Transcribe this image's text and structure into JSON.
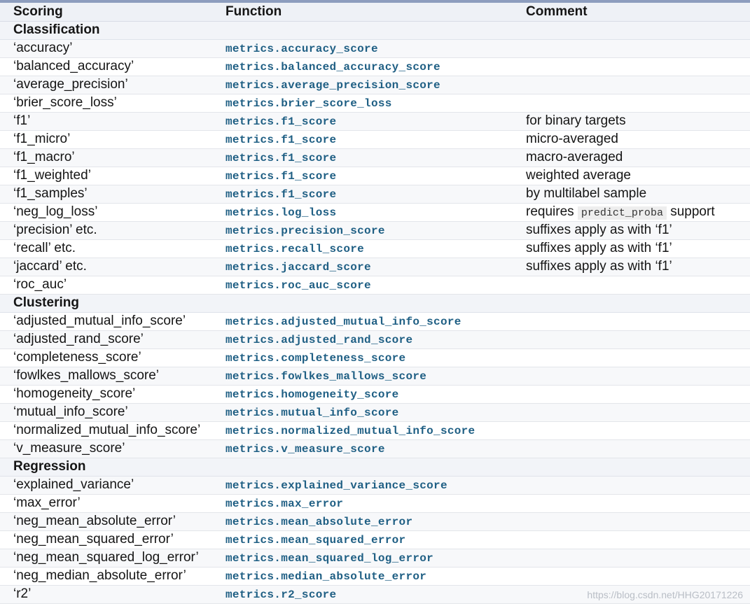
{
  "headers": {
    "scoring": "Scoring",
    "function": "Function",
    "comment": "Comment"
  },
  "sections": [
    {
      "title": "Classification",
      "rows": [
        {
          "scoring": "‘accuracy’",
          "func": "accuracy_score",
          "comment": ""
        },
        {
          "scoring": "‘balanced_accuracy’",
          "func": "balanced_accuracy_score",
          "comment": ""
        },
        {
          "scoring": "‘average_precision’",
          "func": "average_precision_score",
          "comment": ""
        },
        {
          "scoring": "‘brier_score_loss’",
          "func": "brier_score_loss",
          "comment": ""
        },
        {
          "scoring": "‘f1’",
          "func": "f1_score",
          "comment": "for binary targets"
        },
        {
          "scoring": "‘f1_micro’",
          "func": "f1_score",
          "comment": "micro-averaged"
        },
        {
          "scoring": "‘f1_macro’",
          "func": "f1_score",
          "comment": "macro-averaged"
        },
        {
          "scoring": "‘f1_weighted’",
          "func": "f1_score",
          "comment": "weighted average"
        },
        {
          "scoring": "‘f1_samples’",
          "func": "f1_score",
          "comment": "by multilabel sample"
        },
        {
          "scoring": "‘neg_log_loss’",
          "func": "log_loss",
          "comment": "requires ",
          "comment_code": "predict_proba",
          "comment_after": " support"
        },
        {
          "scoring": "‘precision’ etc.",
          "func": "precision_score",
          "comment": "suffixes apply as with ‘f1’"
        },
        {
          "scoring": "‘recall’ etc.",
          "func": "recall_score",
          "comment": "suffixes apply as with ‘f1’"
        },
        {
          "scoring": "‘jaccard’ etc.",
          "func": "jaccard_score",
          "comment": "suffixes apply as with ‘f1’"
        },
        {
          "scoring": "‘roc_auc’",
          "func": "roc_auc_score",
          "comment": ""
        }
      ]
    },
    {
      "title": "Clustering",
      "rows": [
        {
          "scoring": "‘adjusted_mutual_info_score’",
          "func": "adjusted_mutual_info_score",
          "comment": ""
        },
        {
          "scoring": "‘adjusted_rand_score’",
          "func": "adjusted_rand_score",
          "comment": ""
        },
        {
          "scoring": "‘completeness_score’",
          "func": "completeness_score",
          "comment": ""
        },
        {
          "scoring": "‘fowlkes_mallows_score’",
          "func": "fowlkes_mallows_score",
          "comment": ""
        },
        {
          "scoring": "‘homogeneity_score’",
          "func": "homogeneity_score",
          "comment": ""
        },
        {
          "scoring": "‘mutual_info_score’",
          "func": "mutual_info_score",
          "comment": ""
        },
        {
          "scoring": "‘normalized_mutual_info_score’",
          "func": "normalized_mutual_info_score",
          "comment": ""
        },
        {
          "scoring": "‘v_measure_score’",
          "func": "v_measure_score",
          "comment": ""
        }
      ]
    },
    {
      "title": "Regression",
      "rows": [
        {
          "scoring": "‘explained_variance’",
          "func": "explained_variance_score",
          "comment": ""
        },
        {
          "scoring": "‘max_error’",
          "func": "max_error",
          "comment": ""
        },
        {
          "scoring": "‘neg_mean_absolute_error’",
          "func": "mean_absolute_error",
          "comment": ""
        },
        {
          "scoring": "‘neg_mean_squared_error’",
          "func": "mean_squared_error",
          "comment": ""
        },
        {
          "scoring": "‘neg_mean_squared_log_error’",
          "func": "mean_squared_log_error",
          "comment": ""
        },
        {
          "scoring": "‘neg_median_absolute_error’",
          "func": "median_absolute_error",
          "comment": ""
        },
        {
          "scoring": "‘r2’",
          "func": "r2_score",
          "comment": ""
        }
      ]
    }
  ],
  "module_prefix": "metrics.",
  "watermark": "https://blog.csdn.net/HHG20171226"
}
